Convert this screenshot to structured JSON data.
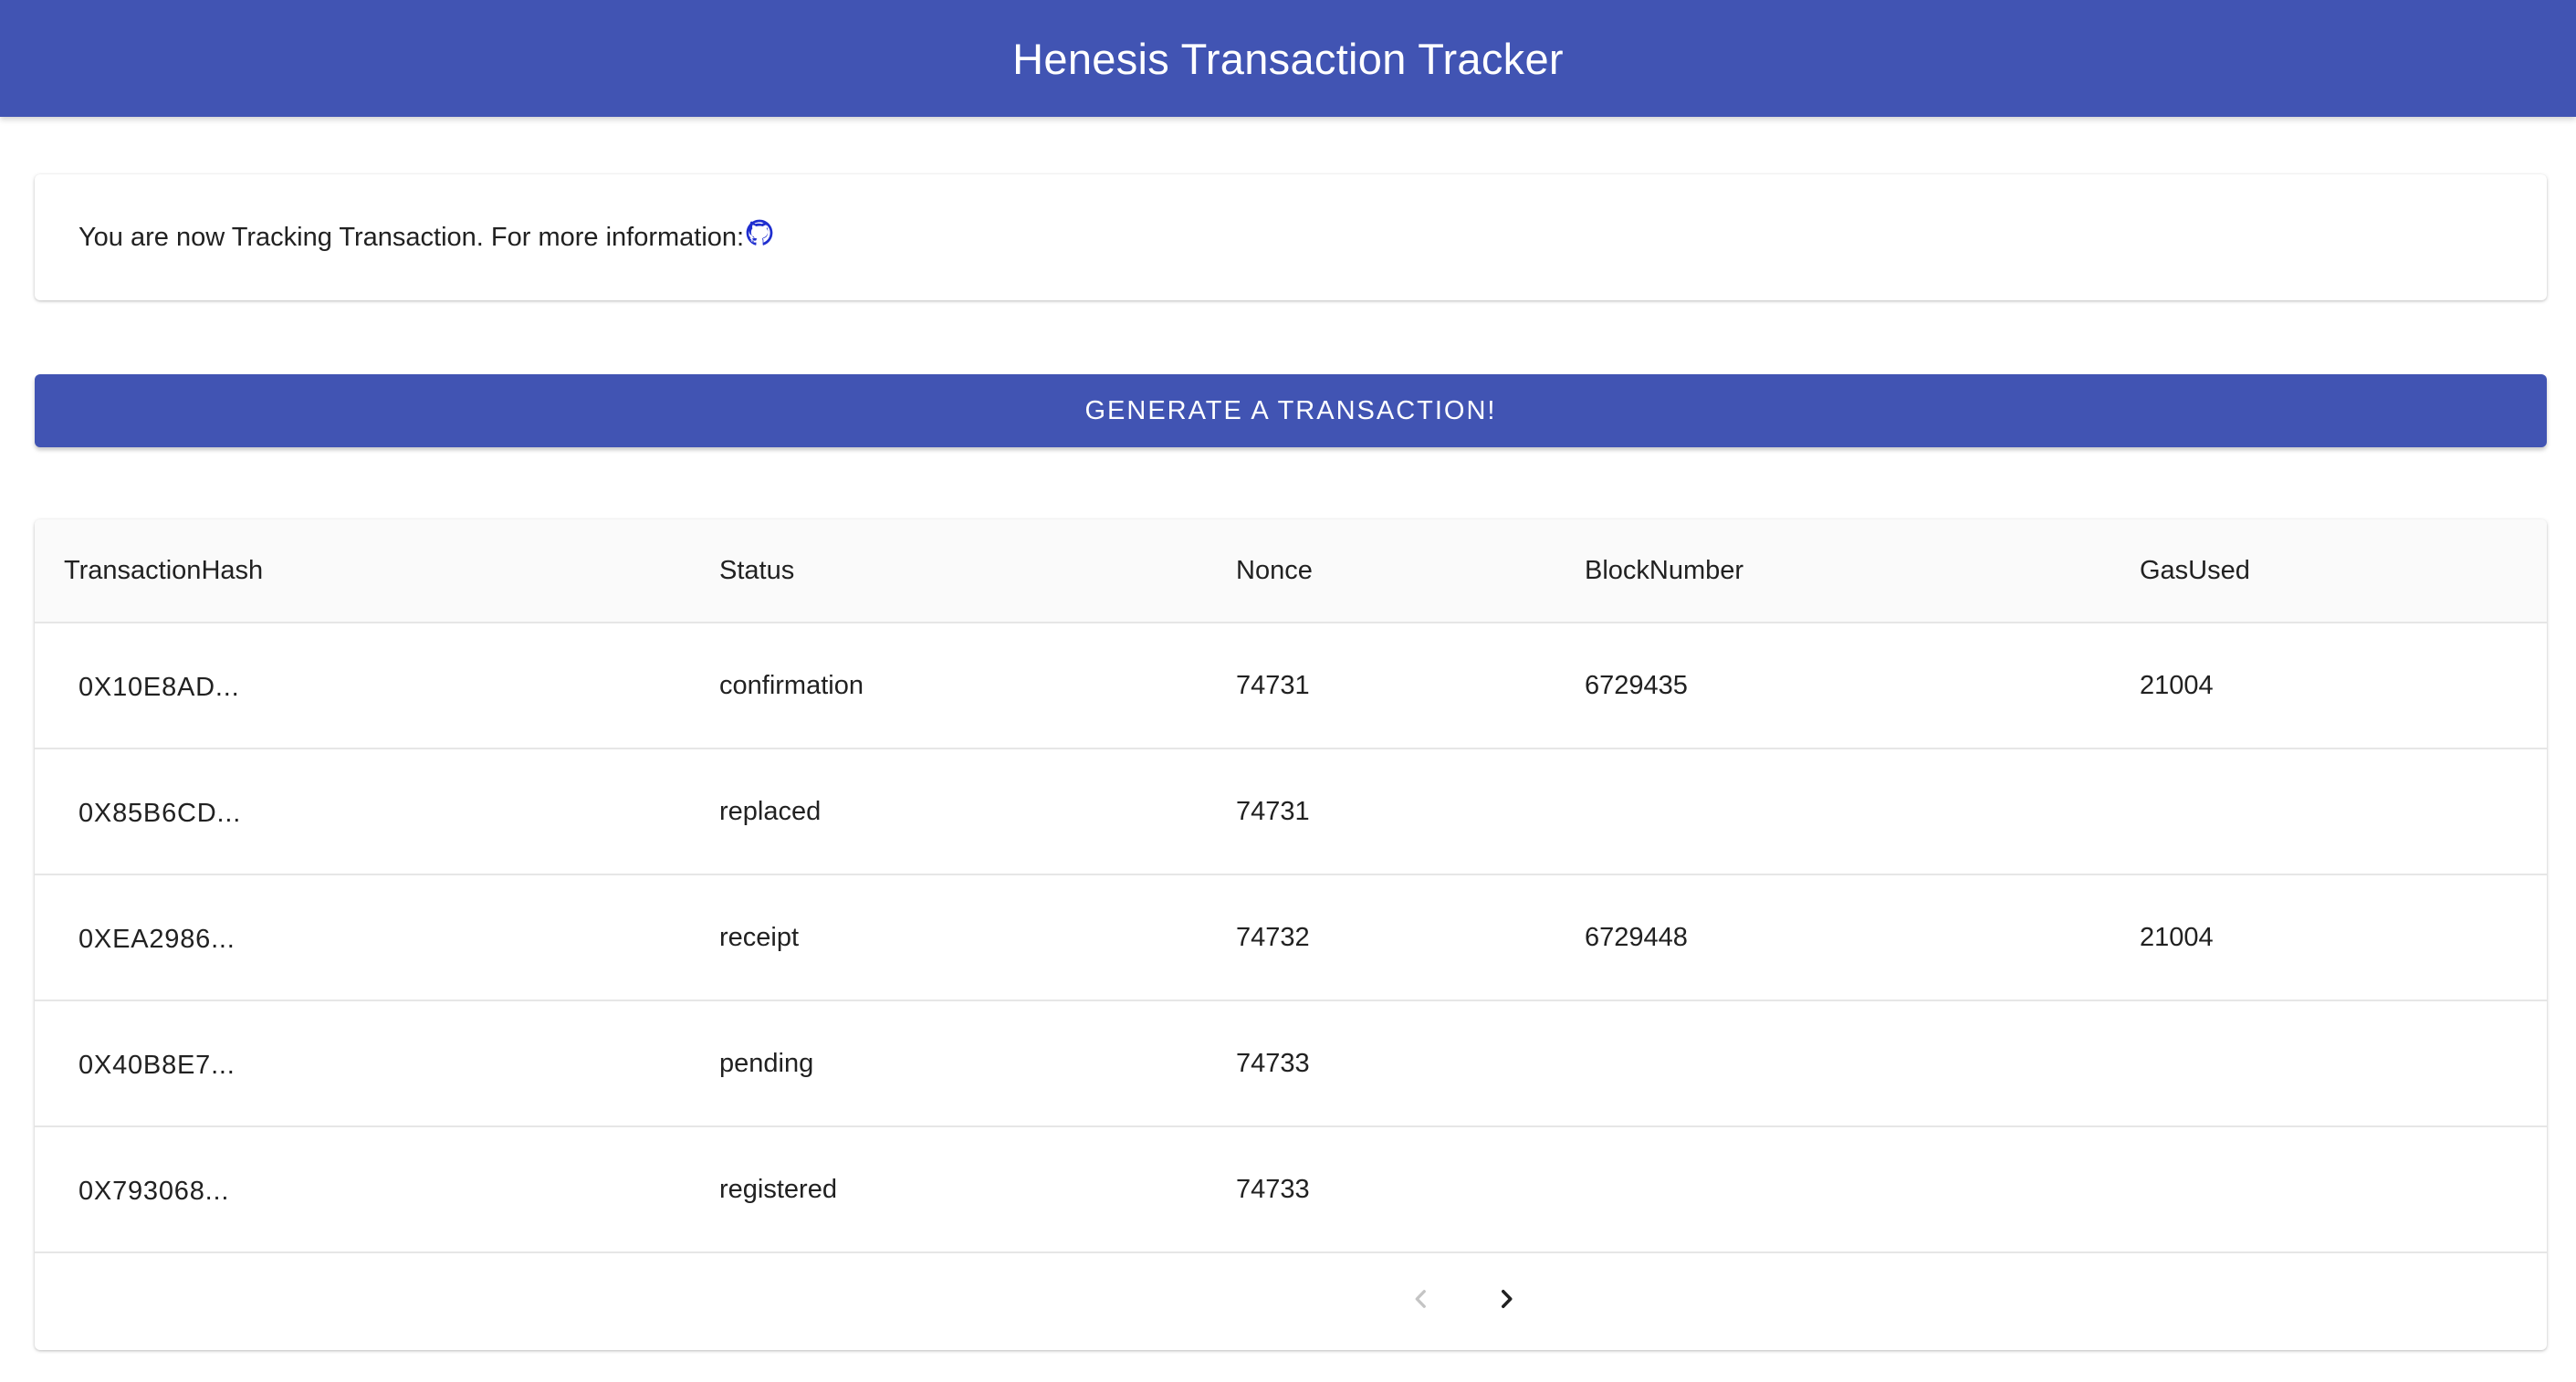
{
  "header": {
    "title": "Henesis Transaction Tracker",
    "color": "#4154b3"
  },
  "info": {
    "text": "You are now Tracking Transaction. For more information:",
    "link_icon": "github-icon"
  },
  "generate_button": {
    "label": "GENERATE A TRANSACTION!"
  },
  "table": {
    "columns": [
      "TransactionHash",
      "Status",
      "Nonce",
      "BlockNumber",
      "GasUsed"
    ],
    "rows": [
      {
        "hash": "0X10E8AD...",
        "status": "confirmation",
        "nonce": "74731",
        "block": "6729435",
        "gas": "21004"
      },
      {
        "hash": "0X85B6CD...",
        "status": "replaced",
        "nonce": "74731",
        "block": "",
        "gas": ""
      },
      {
        "hash": "0XEA2986...",
        "status": "receipt",
        "nonce": "74732",
        "block": "6729448",
        "gas": "21004"
      },
      {
        "hash": "0X40B8E7...",
        "status": "pending",
        "nonce": "74733",
        "block": "",
        "gas": ""
      },
      {
        "hash": "0X793068...",
        "status": "registered",
        "nonce": "74733",
        "block": "",
        "gas": ""
      }
    ]
  },
  "pagination": {
    "prev_icon": "chevron-left-icon",
    "next_icon": "chevron-right-icon",
    "prev_disabled": true
  }
}
